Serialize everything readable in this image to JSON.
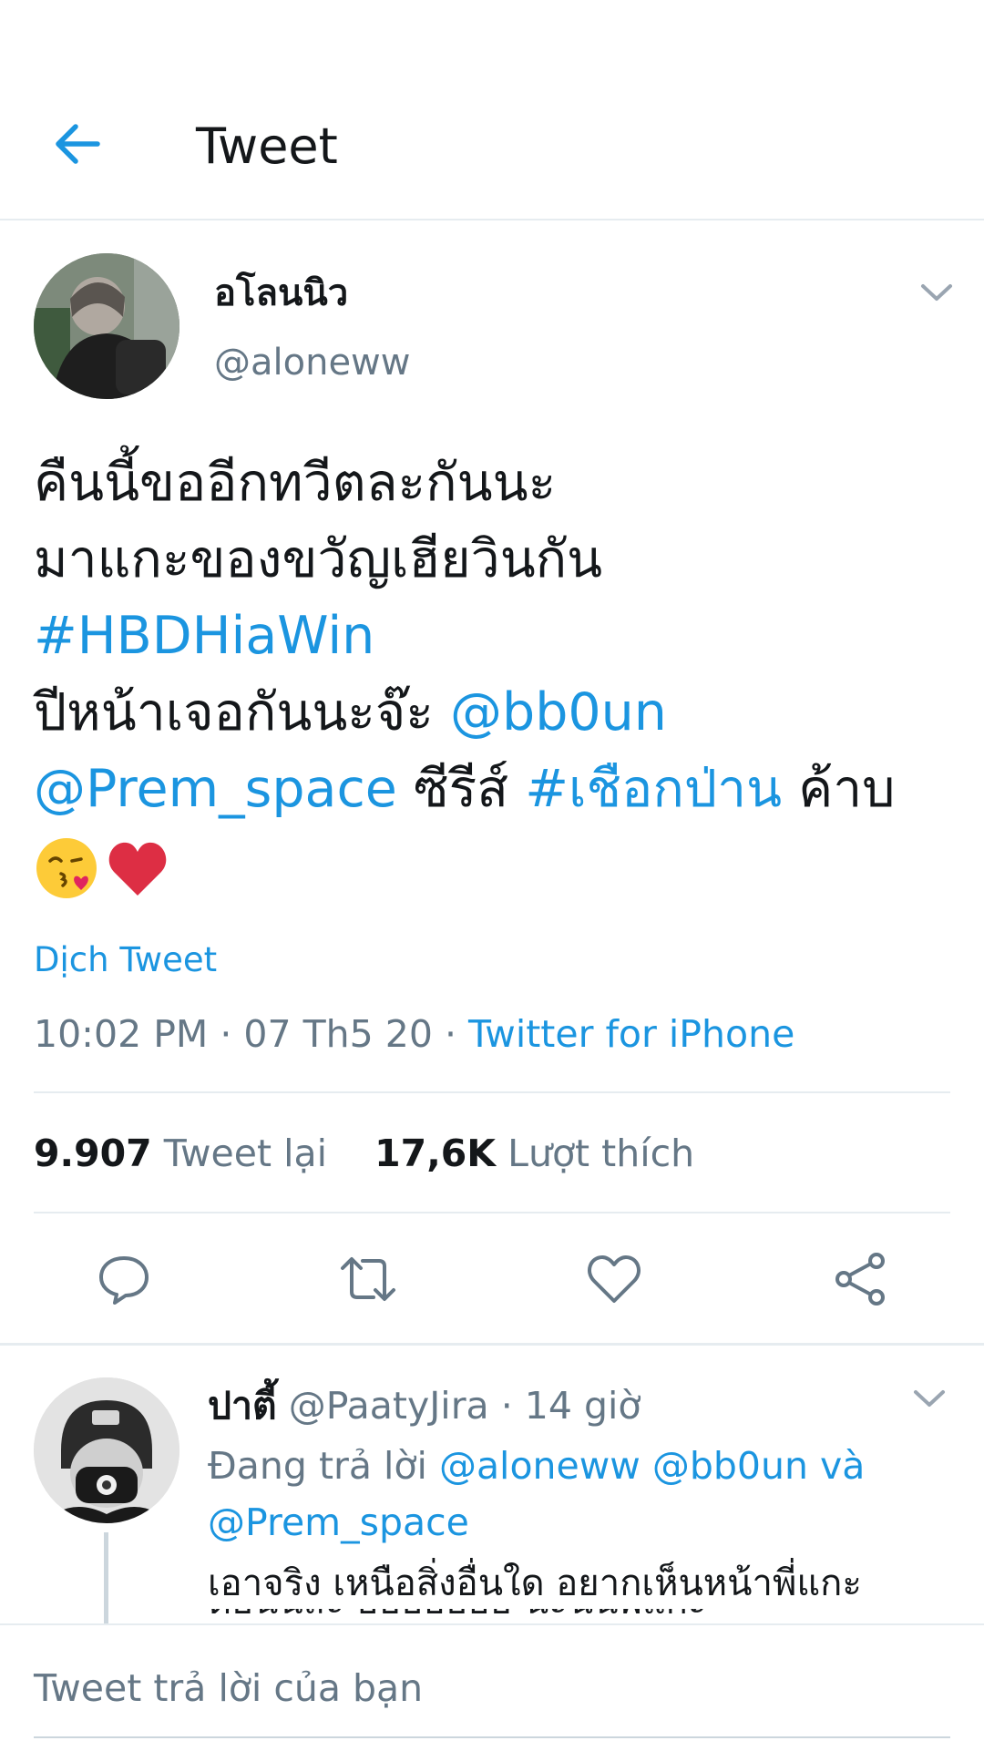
{
  "header": {
    "title": "Tweet"
  },
  "tweet": {
    "author_name": "อโลนนิว",
    "author_handle": "@aloneww",
    "line1": "คืนนี้ขออีกทวีตละกันนะ",
    "line2": "มาแกะของขวัญเฮียวินกัน",
    "hashtag1": "#HBDHiaWin",
    "line4_text": "ปีหน้าเจอกันนะจ๊ะ ",
    "mention1": "@bb0un",
    "mention2": "@Prem_space",
    "series_text": " ซีรีส์ ",
    "hashtag2": "#เชือกป่าน",
    "ending_text": " ค้าบ",
    "translate_label": "Dịch Tweet",
    "time": "10:02 PM",
    "separator": " · ",
    "date": "07 Th5 20",
    "source": "Twitter for iPhone"
  },
  "stats": {
    "retweet_count": "9.907",
    "retweet_label": "Tweet lại",
    "like_count": "17,6K",
    "like_label": "Lượt thích"
  },
  "actions": [
    "reply-icon",
    "retweet-icon",
    "like-icon",
    "share-icon"
  ],
  "reply": {
    "author_name": "ปาตี้",
    "author_handle": "@PaatyJira",
    "time": "14 giờ",
    "replying_prefix": "Đang trả lời ",
    "replying_mention1": "@aloneww",
    "replying_mention2": "@bb0un",
    "replying_and": " và",
    "replying_mention3": "@Prem_space",
    "text": "เอาจริง เหนือสิ่งอื่นใด อยากเห็นหน้าพี่แกะ",
    "text_cut": "ตอนนี้ส่ะ ฮฮฮฮฮฮฮ นะนั้นพี่แกะ"
  },
  "compose": {
    "placeholder": "Tweet trả lời của bạn"
  },
  "colors": {
    "accent": "#1b95e0",
    "secondary_text": "#657786",
    "divider": "#e6ecf0",
    "heart": "#e0245e"
  }
}
